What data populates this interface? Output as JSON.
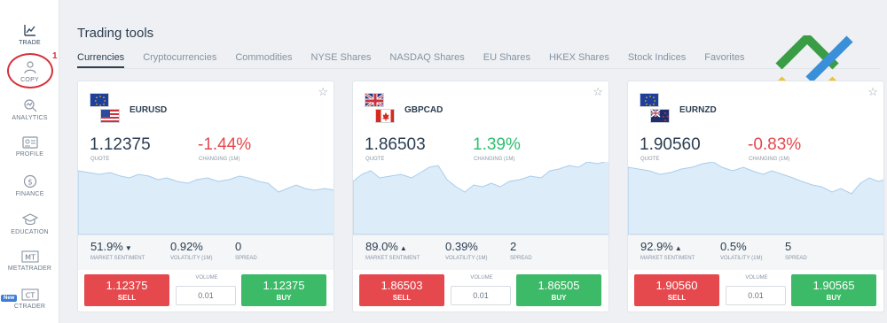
{
  "sidebar": {
    "items": [
      {
        "label": "TRADE",
        "icon": "chart-line-icon"
      },
      {
        "label": "COPY",
        "icon": "user-copy-icon"
      },
      {
        "label": "ANALYTICS",
        "icon": "analytics-icon"
      },
      {
        "label": "PROFILE",
        "icon": "profile-card-icon"
      },
      {
        "label": "FINANCE",
        "icon": "dollar-coin-icon"
      },
      {
        "label": "EDUCATION",
        "icon": "graduation-cap-icon"
      },
      {
        "label": "METATRADER",
        "icon": "mt-icon"
      },
      {
        "label": "CTRADER",
        "icon": "ct-icon"
      }
    ],
    "mt_text": "MT",
    "ct_text": "CT",
    "new_badge": "New",
    "annotation_number": "1",
    "annotation_color": "#d6303a"
  },
  "header": {
    "title": "Trading tools",
    "tabs": [
      "Currencies",
      "Cryptocurrencies",
      "Commodities",
      "NYSE Shares",
      "NASDAQ Shares",
      "EU Shares",
      "HKEX Shares",
      "Stock Indices",
      "Favorites"
    ],
    "active_tab": "Currencies"
  },
  "colors": {
    "sell": "#e5484d",
    "buy": "#3dba68",
    "positive": "#2fbf71",
    "negative": "#e5484d",
    "chart_fill": "#d9ebf8",
    "chart_line": "#a9cdec"
  },
  "labels": {
    "quote": "QUOTE",
    "changing": "CHANGING (1M)",
    "market_sentiment": "MARKET SENTIMENT",
    "volatility": "VOLATILITY (1M)",
    "spread": "SPREAD",
    "volume": "VOLUME",
    "sell": "SELL",
    "buy": "BUY"
  },
  "cards": [
    {
      "pair": "EURUSD",
      "flags": [
        "eu-flag-icon",
        "us-flag-icon"
      ],
      "quote": "1.12375",
      "change": "-1.44%",
      "change_dir": "neg",
      "sentiment": "51.9%",
      "sentiment_dir": "down",
      "volatility": "0.92%",
      "spread": "0",
      "volume": "0.01",
      "sell_price": "1.12375",
      "buy_price": "1.12375"
    },
    {
      "pair": "GBPCAD",
      "flags": [
        "uk-flag-icon",
        "canada-flag-icon"
      ],
      "quote": "1.86503",
      "change": "1.39%",
      "change_dir": "pos",
      "sentiment": "89.0%",
      "sentiment_dir": "up",
      "volatility": "0.39%",
      "spread": "2",
      "volume": "0.01",
      "sell_price": "1.86503",
      "buy_price": "1.86505"
    },
    {
      "pair": "EURNZD",
      "flags": [
        "eu-flag-icon",
        "nz-flag-icon"
      ],
      "quote": "1.90560",
      "change": "-0.83%",
      "change_dir": "neg",
      "sentiment": "92.9%",
      "sentiment_dir": "up",
      "volatility": "0.5%",
      "spread": "5",
      "volume": "0.01",
      "sell_price": "1.90560",
      "buy_price": "1.90565"
    }
  ]
}
